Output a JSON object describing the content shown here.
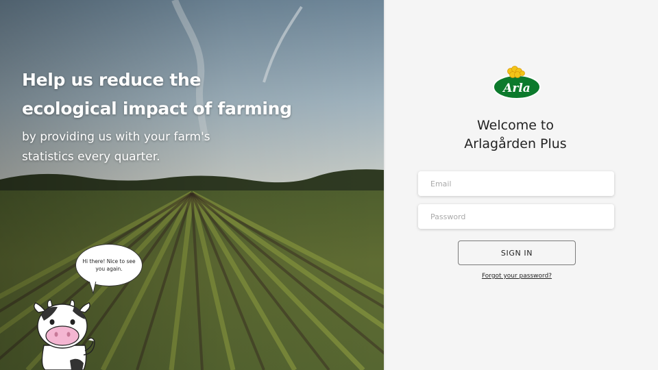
{
  "hero": {
    "title_line1": "Help us reduce the",
    "title_line2": "ecological impact of farming",
    "subtitle": "by providing us with your farm's statistics every quarter.",
    "speech_bubble": "Hi there! Nice to see you again.",
    "mascot_icon": "cow-mascot-icon"
  },
  "brand": {
    "logo_text": "Arla",
    "logo_icon": "arla-logo-icon",
    "green": "#0c7a2c",
    "yellow": "#f2c418"
  },
  "login": {
    "welcome_line1": "Welcome to",
    "welcome_line2": "Arlagården Plus",
    "email_placeholder": "Email",
    "password_placeholder": "Password",
    "signin_label": "SIGN IN",
    "forgot_label": "Forgot your password?"
  }
}
